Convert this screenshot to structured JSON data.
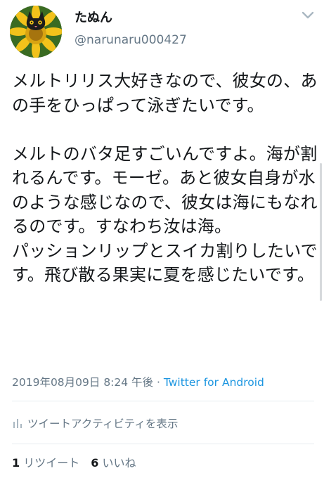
{
  "user": {
    "display_name": "たぬん",
    "handle": "@narunaru000427",
    "avatar_icon": "cat-sunflower-avatar"
  },
  "tweet": {
    "text": "メルトリリス大好きなので、彼女の、あの手をひっぱって泳ぎたいです。\n\nメルトのバタ足すごいんですよ。海が割れるんです。モーゼ。あと彼女自身が水のような感じなので、彼女は海にもなれるのです。すなわち汝は海。\nパッションリップとスイカ割りしたいです。飛び散る果実に夏を感じたいです。",
    "timestamp": "2019年08月09日 8:24 午後",
    "separator": " · ",
    "source": "Twitter for Android"
  },
  "activity": {
    "label": "ツイートアクティビティを表示",
    "icon": "bar-chart-icon"
  },
  "stats": {
    "retweet_count": "1",
    "retweet_label": "リツイート",
    "like_count": "6",
    "like_label": "いいね"
  },
  "colors": {
    "text_primary": "#14171a",
    "text_secondary": "#657786",
    "link": "#1b95e0",
    "divider": "#e6ecf0"
  }
}
